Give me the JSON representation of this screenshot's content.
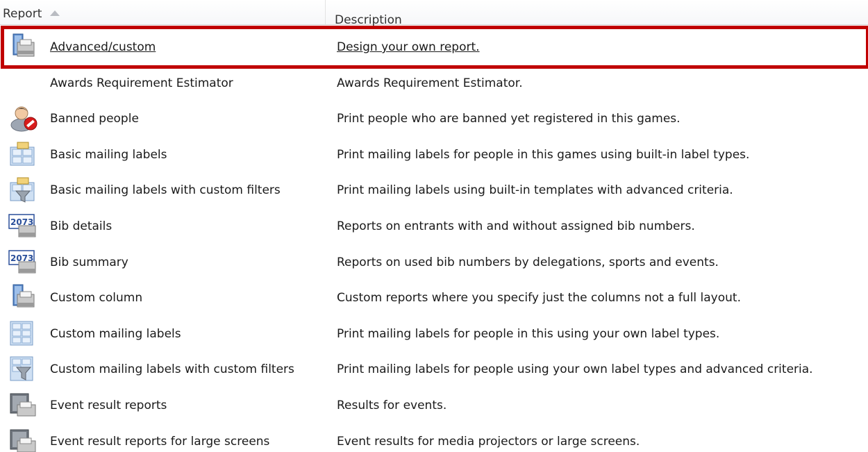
{
  "columns": {
    "report": "Report",
    "description": "Description"
  },
  "rows": [
    {
      "name": "Advanced/custom",
      "description": "Design your own report.",
      "icon": "printer-report-icon"
    },
    {
      "name": "Awards Requirement Estimator",
      "description": "Awards Requirement Estimator.",
      "icon": ""
    },
    {
      "name": "Banned people",
      "description": "Print people who are banned yet registered in this games.",
      "icon": "banned-person-icon"
    },
    {
      "name": "Basic mailing labels",
      "description": "Print mailing labels for people in this games using built-in label types.",
      "icon": "mailing-labels-icon"
    },
    {
      "name": "Basic mailing labels with custom filters",
      "description": "Print mailing labels using built-in templates with advanced criteria.",
      "icon": "mailing-labels-filter-icon"
    },
    {
      "name": "Bib details",
      "description": "Reports on entrants with and without assigned bib numbers.",
      "icon": "bib-number-icon"
    },
    {
      "name": "Bib summary",
      "description": "Reports on used bib numbers by delegations, sports and events.",
      "icon": "bib-number-icon"
    },
    {
      "name": "Custom column",
      "description": "Custom reports where you specify just the columns not a full layout.",
      "icon": "custom-column-icon"
    },
    {
      "name": "Custom mailing labels",
      "description": "Print mailing labels for people in this using your own label types.",
      "icon": "label-sheet-icon"
    },
    {
      "name": "Custom mailing labels with custom filters",
      "description": "Print mailing labels for people using your own label types and advanced criteria.",
      "icon": "label-sheet-filter-icon"
    },
    {
      "name": "Event result reports",
      "description": "Results for events.",
      "icon": "event-results-icon"
    },
    {
      "name": "Event result reports for large screens",
      "description": "Event results for media projectors or large screens.",
      "icon": "event-results-icon"
    }
  ],
  "bib_icon_number": "2073",
  "selected_index": 0,
  "colors": {
    "selection_border": "#c00000"
  }
}
